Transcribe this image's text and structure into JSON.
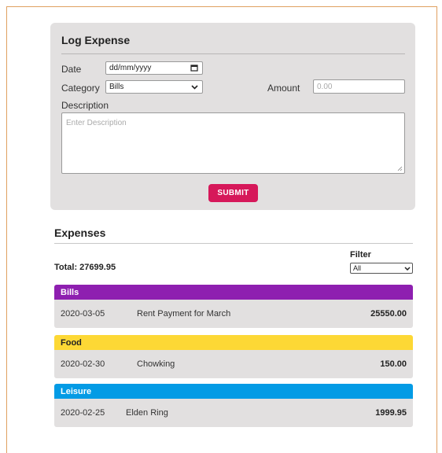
{
  "log_form": {
    "title": "Log Expense",
    "date_label": "Date",
    "date_placeholder": "dd/mm/yyyy",
    "category_label": "Category",
    "category_value": "Bills",
    "amount_label": "Amount",
    "amount_placeholder": "0.00",
    "description_label": "Description",
    "description_placeholder": "Enter Description",
    "submit_label": "SUBMIT"
  },
  "expenses": {
    "title": "Expenses",
    "total_text": "Total: 27699.95",
    "filter_label": "Filter",
    "filter_value": "All",
    "groups": [
      {
        "name": "Bills",
        "color": "#8e1fb0",
        "text_color": "#ffffff",
        "items": [
          {
            "date": "2020-03-05",
            "description": "Rent Payment for March",
            "amount": "25550.00"
          }
        ]
      },
      {
        "name": "Food",
        "color": "#fdd835",
        "text_color": "#222222",
        "items": [
          {
            "date": "2020-02-30",
            "description": "Chowking",
            "amount": "150.00"
          }
        ]
      },
      {
        "name": "Leisure",
        "color": "#039be5",
        "text_color": "#ffffff",
        "items": [
          {
            "date": "2020-02-25",
            "description": "Elden Ring",
            "amount": "1999.95"
          }
        ]
      }
    ]
  },
  "colors": {
    "accent": "#d6185a",
    "card_bg": "#e2e0e0",
    "frame_border": "#e0a060"
  },
  "icons": {
    "date_picker": "calendar-icon",
    "dropdown": "chevron-down-icon",
    "resize": "resize-grip-icon"
  }
}
